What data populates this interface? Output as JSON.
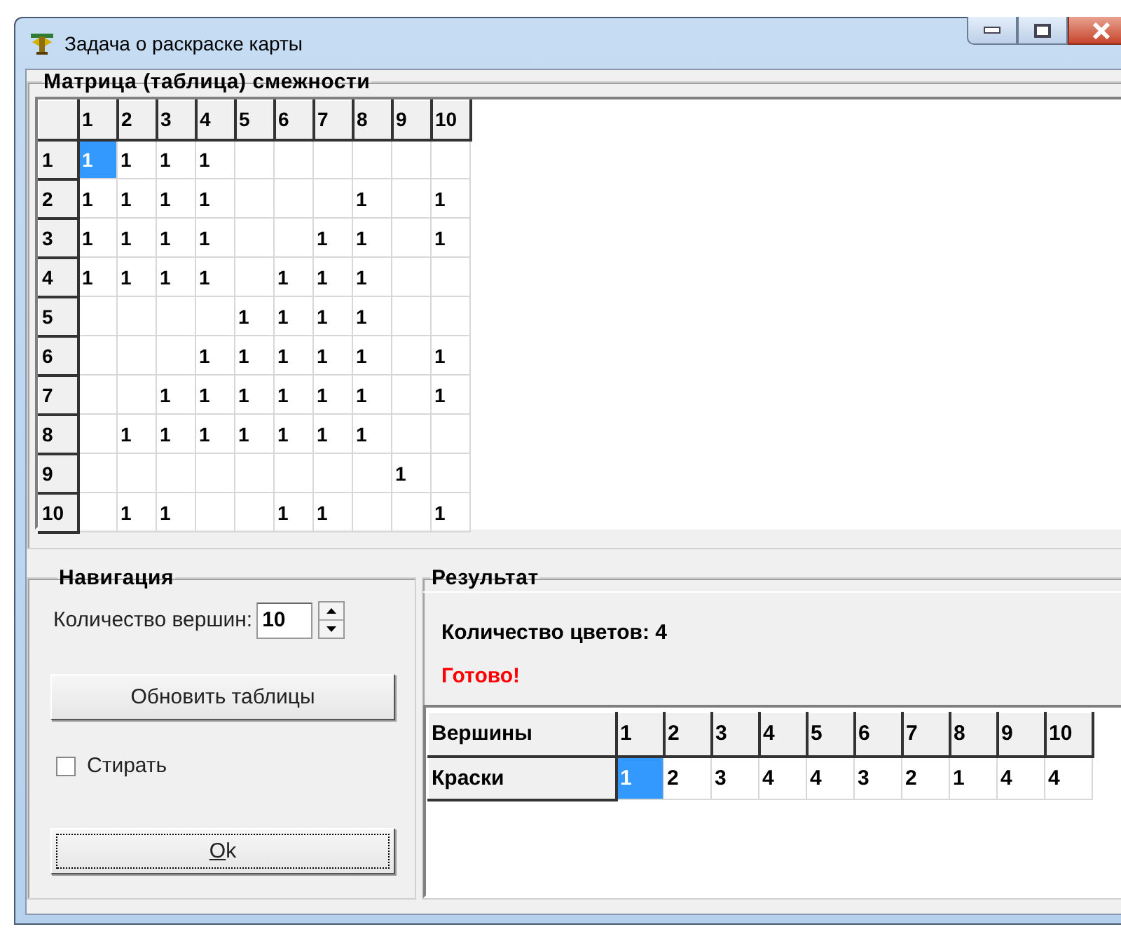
{
  "window": {
    "title": "Задача о раскраске карты"
  },
  "matrix": {
    "title": "Матрица (таблица) смежности",
    "columns": [
      "1",
      "2",
      "3",
      "4",
      "5",
      "6",
      "7",
      "8",
      "9",
      "10"
    ],
    "rows": [
      {
        "label": "1",
        "cells": [
          {
            "text": "1",
            "selected": true
          },
          {
            "text": "1",
            "selected": false
          },
          {
            "text": "1",
            "selected": false
          },
          {
            "text": "1",
            "selected": false
          },
          {
            "selected": false
          },
          {
            "selected": false
          },
          {
            "selected": false
          },
          {
            "selected": false
          },
          {
            "selected": false
          },
          {
            "selected": false
          }
        ]
      },
      {
        "label": "2",
        "cells": [
          {
            "text": "1",
            "selected": false
          },
          {
            "text": "1",
            "selected": false
          },
          {
            "text": "1",
            "selected": false
          },
          {
            "text": "1",
            "selected": false
          },
          {
            "selected": false
          },
          {
            "selected": false
          },
          {
            "selected": false
          },
          {
            "text": "1",
            "selected": false
          },
          {
            "selected": false
          },
          {
            "text": "1",
            "selected": false
          }
        ]
      },
      {
        "label": "3",
        "cells": [
          {
            "text": "1",
            "selected": false
          },
          {
            "text": "1",
            "selected": false
          },
          {
            "text": "1",
            "selected": false
          },
          {
            "text": "1",
            "selected": false
          },
          {
            "selected": false
          },
          {
            "selected": false
          },
          {
            "text": "1",
            "selected": false
          },
          {
            "text": "1",
            "selected": false
          },
          {
            "selected": false
          },
          {
            "text": "1",
            "selected": false
          }
        ]
      },
      {
        "label": "4",
        "cells": [
          {
            "text": "1",
            "selected": false
          },
          {
            "text": "1",
            "selected": false
          },
          {
            "text": "1",
            "selected": false
          },
          {
            "text": "1",
            "selected": false
          },
          {
            "selected": false
          },
          {
            "text": "1",
            "selected": false
          },
          {
            "text": "1",
            "selected": false
          },
          {
            "text": "1",
            "selected": false
          },
          {
            "selected": false
          },
          {
            "selected": false
          }
        ]
      },
      {
        "label": "5",
        "cells": [
          {
            "selected": false
          },
          {
            "selected": false
          },
          {
            "selected": false
          },
          {
            "selected": false
          },
          {
            "text": "1",
            "selected": false
          },
          {
            "text": "1",
            "selected": false
          },
          {
            "text": "1",
            "selected": false
          },
          {
            "text": "1",
            "selected": false
          },
          {
            "selected": false
          },
          {
            "selected": false
          }
        ]
      },
      {
        "label": "6",
        "cells": [
          {
            "selected": false
          },
          {
            "selected": false
          },
          {
            "selected": false
          },
          {
            "text": "1",
            "selected": false
          },
          {
            "text": "1",
            "selected": false
          },
          {
            "text": "1",
            "selected": false
          },
          {
            "text": "1",
            "selected": false
          },
          {
            "text": "1",
            "selected": false
          },
          {
            "selected": false
          },
          {
            "text": "1",
            "selected": false
          }
        ]
      },
      {
        "label": "7",
        "cells": [
          {
            "selected": false
          },
          {
            "selected": false
          },
          {
            "text": "1",
            "selected": false
          },
          {
            "text": "1",
            "selected": false
          },
          {
            "text": "1",
            "selected": false
          },
          {
            "text": "1",
            "selected": false
          },
          {
            "text": "1",
            "selected": false
          },
          {
            "text": "1",
            "selected": false
          },
          {
            "selected": false
          },
          {
            "text": "1",
            "selected": false
          }
        ]
      },
      {
        "label": "8",
        "cells": [
          {
            "selected": false
          },
          {
            "text": "1",
            "selected": false
          },
          {
            "text": "1",
            "selected": false
          },
          {
            "text": "1",
            "selected": false
          },
          {
            "text": "1",
            "selected": false
          },
          {
            "text": "1",
            "selected": false
          },
          {
            "text": "1",
            "selected": false
          },
          {
            "text": "1",
            "selected": false
          },
          {
            "selected": false
          },
          {
            "selected": false
          }
        ]
      },
      {
        "label": "9",
        "cells": [
          {
            "selected": false
          },
          {
            "selected": false
          },
          {
            "selected": false
          },
          {
            "selected": false
          },
          {
            "selected": false
          },
          {
            "selected": false
          },
          {
            "selected": false
          },
          {
            "selected": false
          },
          {
            "text": "1",
            "selected": false
          },
          {
            "selected": false
          }
        ]
      },
      {
        "label": "10",
        "cells": [
          {
            "selected": false
          },
          {
            "text": "1",
            "selected": false
          },
          {
            "text": "1",
            "selected": false
          },
          {
            "selected": false
          },
          {
            "selected": false
          },
          {
            "text": "1",
            "selected": false
          },
          {
            "text": "1",
            "selected": false
          },
          {
            "selected": false
          },
          {
            "selected": false
          },
          {
            "text": "1",
            "selected": false
          }
        ]
      }
    ]
  },
  "navigation": {
    "title": "Навигация",
    "count_label": "Количество вершин:",
    "count_value": "10",
    "refresh_button": "Обновить таблицы",
    "erase": {
      "label": "Стирать",
      "checked": false
    },
    "ok_button": "Ok"
  },
  "result": {
    "title": "Результат",
    "colors_count": "Количество цветов: 4",
    "status": "Готово!",
    "table": {
      "header": "Вершины",
      "columns": [
        "1",
        "2",
        "3",
        "4",
        "5",
        "6",
        "7",
        "8",
        "9",
        "10"
      ],
      "row_label": "Краски",
      "cells": [
        {
          "text": "1",
          "selected": true
        },
        {
          "text": "2",
          "selected": false
        },
        {
          "text": "3",
          "selected": false
        },
        {
          "text": "4",
          "selected": false
        },
        {
          "text": "4",
          "selected": false
        },
        {
          "text": "3",
          "selected": false
        },
        {
          "text": "2",
          "selected": false
        },
        {
          "text": "1",
          "selected": false
        },
        {
          "text": "4",
          "selected": false
        },
        {
          "text": "4",
          "selected": false
        }
      ]
    }
  }
}
